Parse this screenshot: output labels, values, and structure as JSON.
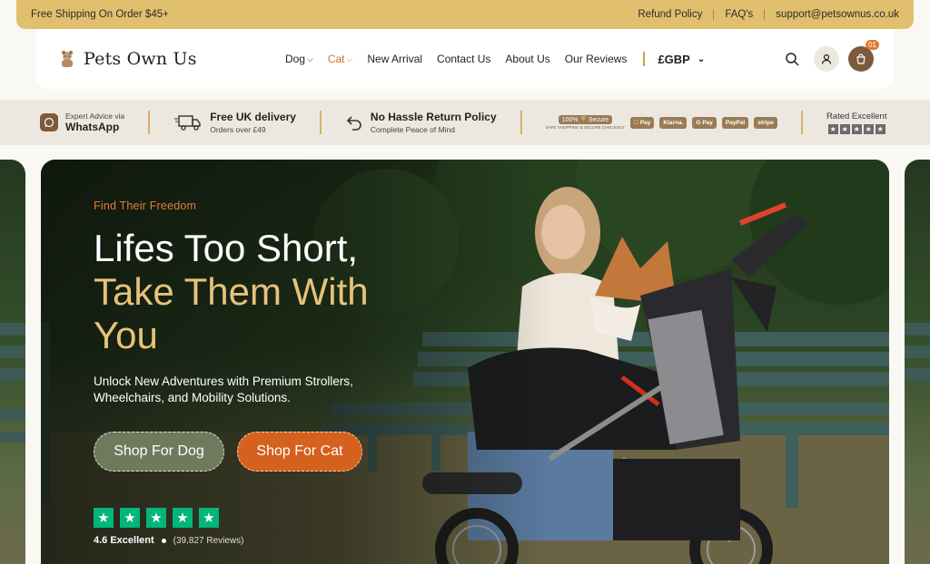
{
  "topbar": {
    "shipping": "Free Shipping On Order $45+",
    "links": [
      "Refund Policy",
      "FAQ's",
      "support@petsownus.co.uk"
    ]
  },
  "header": {
    "logo_text": "Pets Own Us",
    "nav": [
      {
        "label": "Dog",
        "dropdown": true,
        "active": false
      },
      {
        "label": "Cat",
        "dropdown": true,
        "active": true
      },
      {
        "label": "New Arrival",
        "dropdown": false,
        "active": false
      },
      {
        "label": "Contact Us",
        "dropdown": false,
        "active": false
      },
      {
        "label": "About Us",
        "dropdown": false,
        "active": false
      },
      {
        "label": "Our Reviews",
        "dropdown": false,
        "active": false
      }
    ],
    "currency": "£GBP",
    "cart_count": "01",
    "icons": [
      "search-icon",
      "user-icon",
      "cart-icon"
    ]
  },
  "benefits": {
    "whatsapp": {
      "line1": "Expert Advice via",
      "line2": "WhatsApp"
    },
    "delivery": {
      "line1": "Free UK delivery",
      "line2": "Orders over £49"
    },
    "returns": {
      "line1": "No Hassle Return Policy",
      "line2": "Complete Peace of Mind"
    },
    "secure": {
      "label_pct": "100%",
      "label_word": "Secure",
      "sub": "SAFE SHOPPING & SECURE CHECKOUT"
    },
    "payments": [
      "Pay",
      "Klarna.",
      "G Pay",
      "PayPal",
      "stripe"
    ],
    "rated": {
      "label": "Rated Excellent",
      "stars": 5
    }
  },
  "hero": {
    "eyebrow": "Find Their Freedom",
    "headline_line1": "Lifes Too Short,",
    "headline_line2": "Take Them With",
    "headline_line3": "You",
    "description": "Unlock New Adventures with Premium Strollers, Wheelchairs, and Mobility Solutions.",
    "btn_dog": "Shop For Dog",
    "btn_cat": "Shop For Cat",
    "trustpilot": {
      "stars": 5,
      "score": "4.6 Excellent",
      "reviews": "(39,827 Reviews)"
    }
  },
  "colors": {
    "gold": "#e0c06e",
    "accent_orange": "#d4611e",
    "brown": "#7c5a3c",
    "trustpilot_green": "#00b67a"
  }
}
